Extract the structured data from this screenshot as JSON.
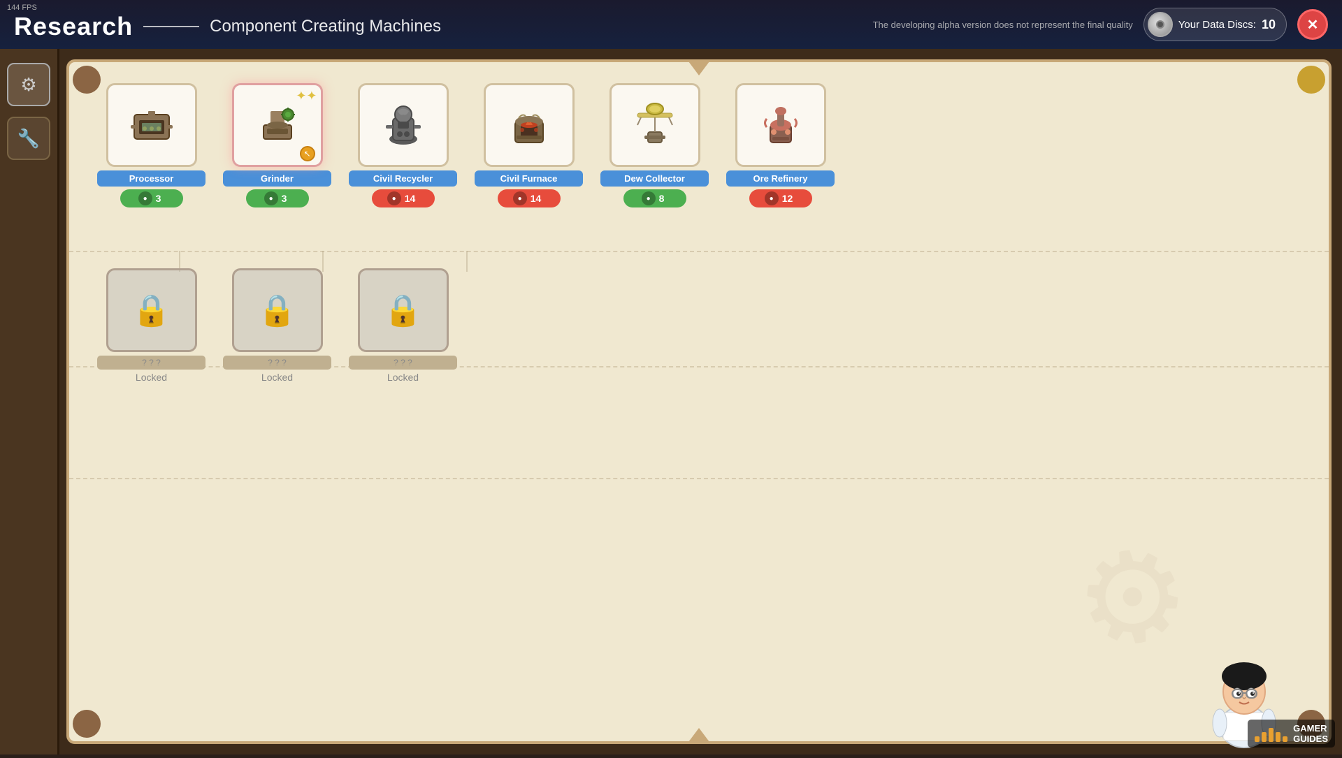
{
  "fps": "144 FPS",
  "header": {
    "title": "Research",
    "subtitle": "Component Creating Machines",
    "alpha_notice": "The developing alpha version does not represent the final quality",
    "data_discs_label": "Your Data Discs:",
    "data_discs_count": "10"
  },
  "close_button": "✕",
  "sidebar": {
    "buttons": [
      {
        "id": "settings",
        "icon": "⚙",
        "label": "settings-button",
        "active": true
      },
      {
        "id": "tools",
        "icon": "🔧",
        "label": "tools-button",
        "active": false
      }
    ]
  },
  "machines": [
    {
      "id": "processor",
      "name": "Processor",
      "cost": 3,
      "cost_color": "green",
      "locked": false,
      "selected": false,
      "icon": "🖥"
    },
    {
      "id": "grinder",
      "name": "Grinder",
      "cost": 3,
      "cost_color": "green",
      "locked": false,
      "selected": true,
      "icon": "⚙"
    },
    {
      "id": "civil_recycler",
      "name": "Civil Recycler",
      "cost": 14,
      "cost_color": "red",
      "locked": false,
      "selected": false,
      "icon": "♻"
    },
    {
      "id": "civil_furnace",
      "name": "Civil Furnace",
      "cost": 14,
      "cost_color": "red",
      "locked": false,
      "selected": false,
      "icon": "🔥"
    },
    {
      "id": "dew_collector",
      "name": "Dew Collector",
      "cost": 8,
      "cost_color": "green",
      "locked": false,
      "selected": false,
      "icon": "💧"
    },
    {
      "id": "ore_refinery",
      "name": "Ore Refinery",
      "cost": 12,
      "cost_color": "red",
      "locked": false,
      "selected": false,
      "icon": "⛏"
    }
  ],
  "locked_machines": [
    {
      "id": "locked1",
      "label": "? ? ?",
      "name": "Locked"
    },
    {
      "id": "locked2",
      "label": "? ? ?",
      "name": "Locked"
    },
    {
      "id": "locked3",
      "label": "? ? ?",
      "name": "Locked"
    }
  ]
}
